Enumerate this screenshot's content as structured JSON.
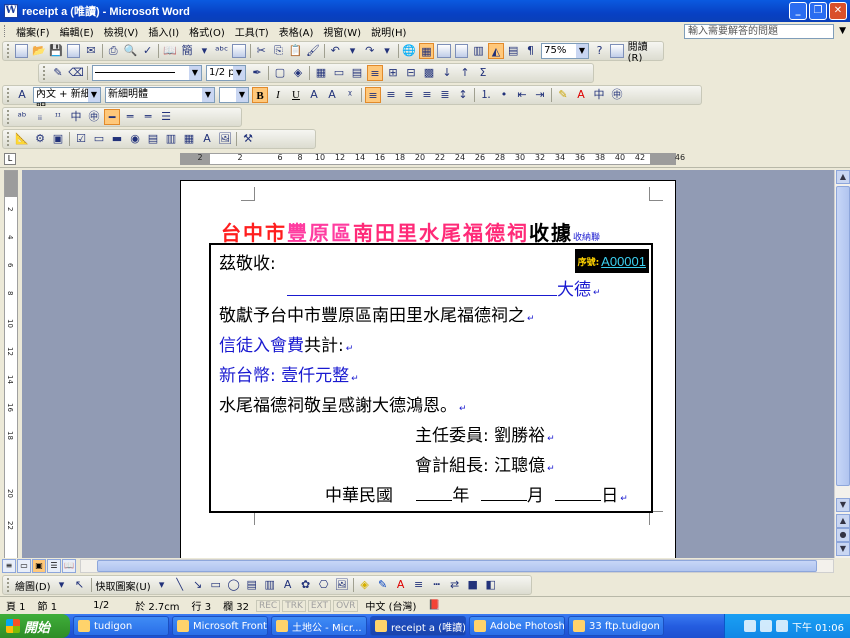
{
  "window": {
    "title": "receipt a (唯讀) - Microsoft Word",
    "app_icon": "W"
  },
  "menubar": {
    "items": [
      "檔案(F)",
      "編輯(E)",
      "檢視(V)",
      "插入(I)",
      "格式(O)",
      "工具(T)",
      "表格(A)",
      "視窗(W)",
      "說明(H)"
    ],
    "help_placeholder": "輸入需要解答的問題"
  },
  "toolbar_standard": {
    "zoom": "75%",
    "read_label": "閱讀(R)",
    "font_toggle": "簡"
  },
  "toolbar_tables": {
    "line_weight": "1/2 p"
  },
  "toolbar_formatting": {
    "style": "內文 + 新細明",
    "font": "新細明體"
  },
  "ruler": {
    "numbers": [
      "2",
      "",
      "2",
      "",
      "6",
      "8",
      "10",
      "12",
      "14",
      "16",
      "18",
      "20",
      "22",
      "24",
      "26",
      "28",
      "30",
      "32",
      "34",
      "36",
      "38",
      "40",
      "42",
      "",
      "46"
    ]
  },
  "vruler": {
    "numbers": [
      "2",
      "4",
      "6",
      "8",
      "10",
      "12",
      "14",
      "16",
      "18",
      "20",
      "22"
    ]
  },
  "document": {
    "title_part1": "台中市",
    "title_part2": "豐原區",
    "title_part3": "南田里水尾福德祠",
    "title_part4": "收據",
    "title_note": "收納聯",
    "received": "茲敬收:",
    "receipt_no_label": "序號:",
    "receipt_no": "A00001",
    "donor": "大德",
    "line_donate": "敬獻予台中市豐原區南田里水尾福德祠之",
    "fee_label": "信徒入會費",
    "fee_suffix": "共計:",
    "amount": "新台幣: 壹仟元整",
    "thanks": "水尾福德祠敬呈感謝大德鴻恩。",
    "chair": "主任委員: 劉勝裕",
    "accountant": "會計組長: 江聰億",
    "date_prefix": "中華民國",
    "year": "年",
    "month": "月",
    "day": "日",
    "paragraph_mark": "↵"
  },
  "drawing_toolbar": {
    "draw_label": "繪圖(D)",
    "autoshape_label": "快取圖案(U)"
  },
  "statusbar": {
    "page": "頁 1",
    "section": "節 1",
    "page_of": "1/2",
    "at": "於 2.7cm",
    "line": "行 3",
    "col": "欄 32",
    "rec": "REC",
    "trk": "TRK",
    "ext": "EXT",
    "ovr": "OVR",
    "lang": "中文 (台灣)"
  },
  "taskbar": {
    "start": "開始",
    "tasks": [
      "tudigon",
      "Microsoft Front...",
      "土地公 - Micr...",
      "receipt a (唯讀)...",
      "Adobe Photoshop",
      "33 ftp.tudigon -..."
    ],
    "clock": "下午 01:06"
  },
  "colors": {
    "title_red": "#ff1e1e",
    "title_pink": "#ff3ca0",
    "blue_text": "#1a1ad0",
    "xp_blue": "#0a5ae0"
  }
}
